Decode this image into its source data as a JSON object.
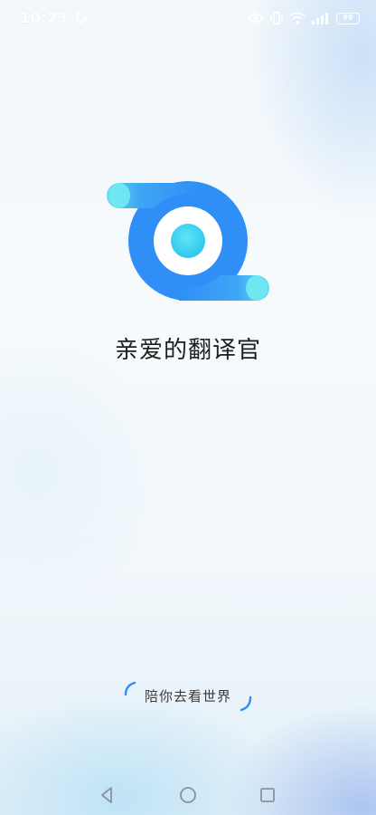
{
  "status_bar": {
    "time": "10:23",
    "battery": "99"
  },
  "splash": {
    "app_name": "亲爱的翻译官",
    "tagline": "陪你去看世界"
  },
  "colors": {
    "brand_blue": "#2f8ff6",
    "brand_cyan": "#34cdf0",
    "background": "#f4f9fc"
  },
  "icons": {
    "status": [
      "notification-icon",
      "eye-icon",
      "vibrate-icon",
      "wifi-icon",
      "signal-icon",
      "battery-icon"
    ],
    "nav": [
      "back-icon",
      "home-icon",
      "recent-apps-icon"
    ]
  }
}
